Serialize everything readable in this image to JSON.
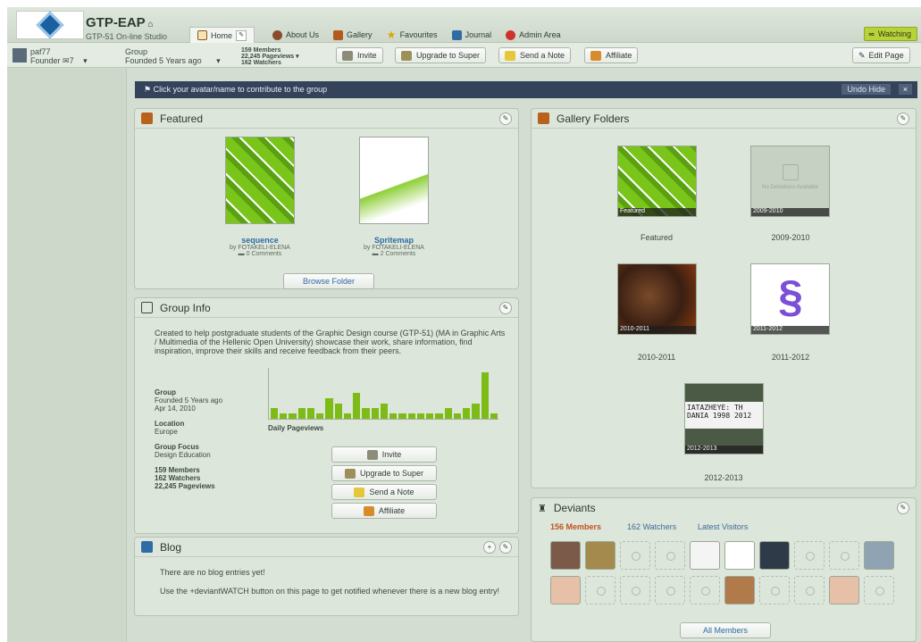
{
  "header": {
    "group_name": "GTP-EAP",
    "group_subtitle": "GTP-51 On-line Studio",
    "watching_label": "Watching",
    "tabs": [
      {
        "label": "Home",
        "icon": "home-icon"
      },
      {
        "label": "About Us",
        "icon": "about-icon"
      },
      {
        "label": "Gallery",
        "icon": "gallery-icon"
      },
      {
        "label": "Favourites",
        "icon": "star-icon"
      },
      {
        "label": "Journal",
        "icon": "journal-icon"
      },
      {
        "label": "Admin Area",
        "icon": "admin-icon"
      }
    ]
  },
  "subbar": {
    "user_name": "paf77",
    "user_role": "Founder",
    "message_count": "7",
    "group_type": "Group",
    "group_founded": "Founded 5 Years ago",
    "stat_members": "159 Members",
    "stat_pageviews": "22,245 Pageviews",
    "stat_watchers": "162 Watchers",
    "invite": "Invite",
    "upgrade": "Upgrade to Super",
    "send_note": "Send a Note",
    "affiliate": "Affiliate",
    "edit_page": "Edit Page"
  },
  "notice": {
    "text": "Click your avatar/name to contribute to the group",
    "undo": "Undo Hide",
    "close": "×"
  },
  "featured": {
    "title": "Featured",
    "items": [
      {
        "title": "sequence",
        "by": "by FOTAKELI-ELENA",
        "comments": "0 Comments"
      },
      {
        "title": "Spritemap",
        "by": "by FOTAKELI-ELENA",
        "comments": "2 Comments"
      }
    ],
    "browse": "Browse Folder"
  },
  "group_info": {
    "title": "Group Info",
    "description": "Created to help postgraduate students of the Graphic Design course (GTP-51) (MA in Graphic Arts / Multimedia of the Hellenic Open University) showcase their work, share information, find inspiration, improve their skills and receive feedback from their peers.",
    "group_label": "Group",
    "founded": "Founded 5 Years ago",
    "founded_date": "Apr 14, 2010",
    "location_label": "Location",
    "location": "Europe",
    "focus_label": "Group Focus",
    "focus": "Design Education",
    "members": "159 Members",
    "watchers": "162 Watchers",
    "pageviews": "22,245 Pageviews",
    "chart_label": "Daily Pageviews",
    "invite": "Invite",
    "upgrade": "Upgrade to Super",
    "send_note": "Send a Note",
    "affiliate": "Affiliate"
  },
  "pageviews_bars": [
    2,
    1,
    1,
    2,
    2,
    1,
    4,
    3,
    1,
    5,
    2,
    2,
    3,
    1,
    1,
    1,
    1,
    1,
    1,
    2,
    1,
    2,
    3,
    9,
    1
  ],
  "blog": {
    "title": "Blog",
    "empty": "There are no blog entries yet!",
    "hint": "Use the +deviantWATCH button on this page to get notified whenever there is a new blog entry!"
  },
  "gallery_folders": {
    "title": "Gallery Folders",
    "folders": [
      {
        "name": "Featured",
        "label": "Featured"
      },
      {
        "name": "2009-2010",
        "label": "2009-2010",
        "empty_text": "No Deviations Available"
      },
      {
        "name": "2010-2011",
        "label": "2010-2011"
      },
      {
        "name": "2011-2012",
        "label": "2011-2012"
      },
      {
        "name": "2012-2013",
        "label": "2012-2013",
        "art_text": "IATAZHEYE: TH DANIA 1998 2012"
      }
    ]
  },
  "deviants": {
    "title": "Deviants",
    "tab_members": "156 Members",
    "tab_watchers": "162 Watchers",
    "tab_visitors": "Latest Visitors",
    "all_members": "All Members"
  }
}
